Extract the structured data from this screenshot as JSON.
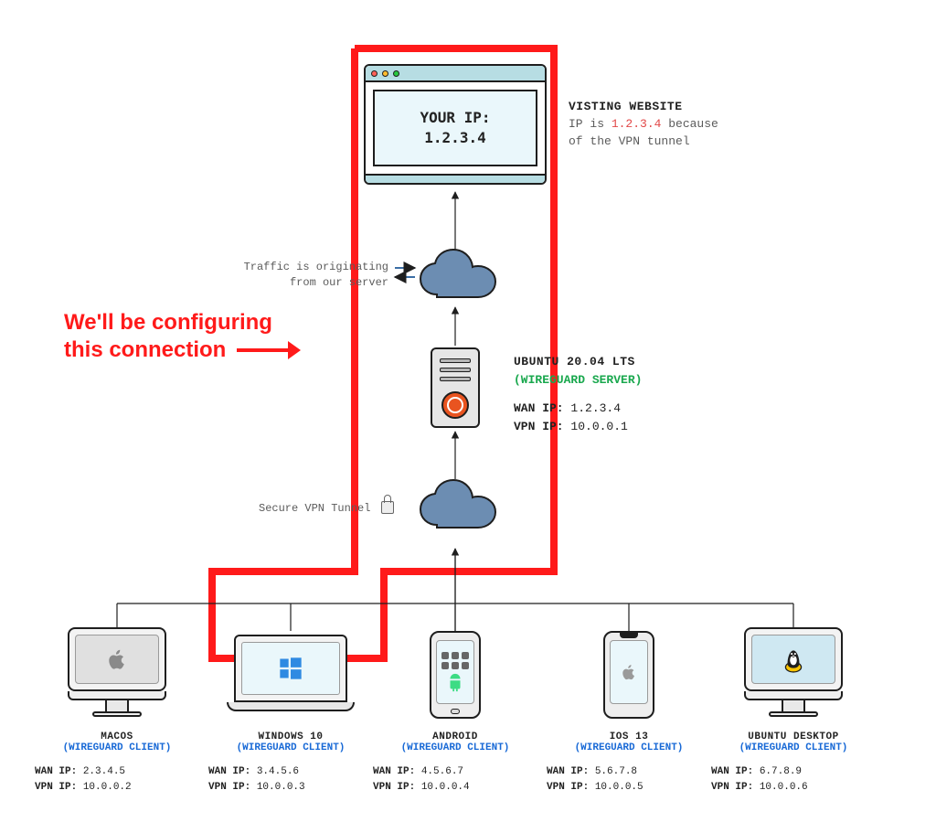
{
  "website": {
    "line1": "YOUR IP:",
    "line2": "1.2.3.4",
    "caption_title": "VISTING WEBSITE",
    "caption_l1a": "IP is ",
    "caption_l1_ip": "1.2.3.4",
    "caption_l1b": " because",
    "caption_l2": "of the VPN tunnel"
  },
  "traffic_label_l1": "Traffic is originating",
  "traffic_label_l2": "from our server",
  "tunnel_label": "Secure VPN Tunnel",
  "server": {
    "title": "UBUNTU 20.04 LTS",
    "role": "(WIREGUARD SERVER)",
    "wan_label": "WAN IP:",
    "wan_ip": "1.2.3.4",
    "vpn_label": "VPN IP:",
    "vpn_ip": "10.0.0.1"
  },
  "callout_l1": "We'll be configuring",
  "callout_l2": "this connection",
  "clients": [
    {
      "os": "MACOS",
      "role": "(WIREGUARD CLIENT)",
      "wan": "2.3.4.5",
      "vpn": "10.0.0.2"
    },
    {
      "os": "WINDOWS 10",
      "role": "(WIREGUARD CLIENT)",
      "wan": "3.4.5.6",
      "vpn": "10.0.0.3"
    },
    {
      "os": "ANDROID",
      "role": "(WIREGUARD CLIENT)",
      "wan": "4.5.6.7",
      "vpn": "10.0.0.4"
    },
    {
      "os": "IOS 13",
      "role": "(WIREGUARD CLIENT)",
      "wan": "5.6.7.8",
      "vpn": "10.0.0.5"
    },
    {
      "os": "UBUNTU DESKTOP",
      "role": "(WIREGUARD CLIENT)",
      "wan": "6.7.8.9",
      "vpn": "10.0.0.6"
    }
  ],
  "kv": {
    "wan": "WAN IP:",
    "vpn": "VPN IP:"
  }
}
